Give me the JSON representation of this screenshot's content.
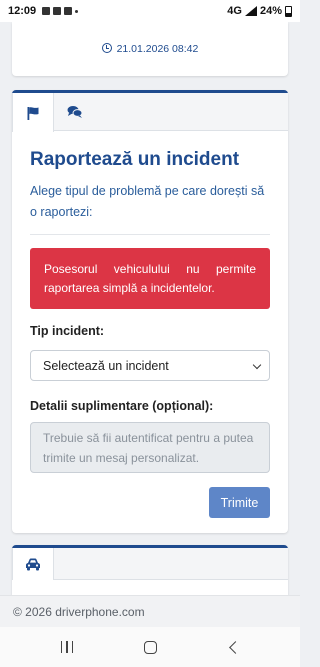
{
  "status_bar": {
    "time": "12:09",
    "network": "4G",
    "battery": "24%"
  },
  "top_card": {
    "timestamp": "21.01.2026 08:42"
  },
  "report_panel": {
    "tabs": [
      {
        "icon": "flag-icon",
        "active": true
      },
      {
        "icon": "comments-icon",
        "active": false
      }
    ],
    "title": "Raportează un incident",
    "description": "Alege tipul de problemă pe care dorești să o raportezi:",
    "alert": "Posesorul vehiculului nu permite raportarea simplă a incidentelor.",
    "incident_type_label": "Tip incident:",
    "incident_select_value": "Selectează un incident",
    "details_label": "Detalii suplimentare (opțional):",
    "details_placeholder": "Trebuie să fii autentificat pentru a putea trimite un mesaj personalizat.",
    "submit_label": "Trimite"
  },
  "vehicle_card": {
    "tab_icon": "car-icon"
  },
  "footer": {
    "copyright": "© 2026 driverphone.com"
  },
  "colors": {
    "accent": "#1f4b8e",
    "alert": "#dc3545",
    "button": "#5e86c8"
  }
}
